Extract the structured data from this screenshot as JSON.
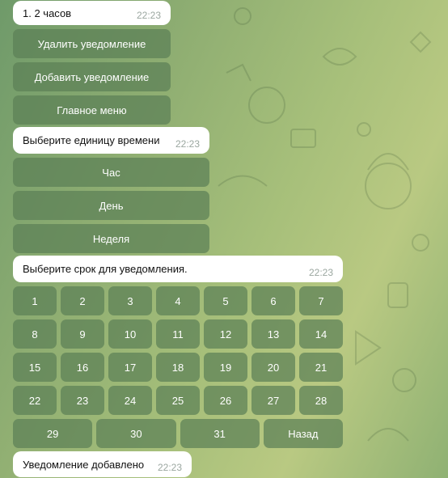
{
  "messages": {
    "m1": {
      "text": "1. 2 часов",
      "time": "22:23"
    },
    "m2": {
      "text": "Выберите единицу времени",
      "time": "22:23"
    },
    "m3": {
      "text": "Выберите срок для уведомления.",
      "time": "22:23"
    },
    "m4": {
      "text": "Уведомление добавлено",
      "time": "22:23"
    }
  },
  "menu_keyboard": [
    "Удалить уведомление",
    "Добавить уведомление",
    "Главное меню"
  ],
  "unit_keyboard": [
    "Час",
    "День",
    "Неделя"
  ],
  "days": [
    "1",
    "2",
    "3",
    "4",
    "5",
    "6",
    "7",
    "8",
    "9",
    "10",
    "11",
    "12",
    "13",
    "14",
    "15",
    "16",
    "17",
    "18",
    "19",
    "20",
    "21",
    "22",
    "23",
    "24",
    "25",
    "26",
    "27",
    "28"
  ],
  "last_row": [
    "29",
    "30",
    "31",
    "Назад"
  ]
}
